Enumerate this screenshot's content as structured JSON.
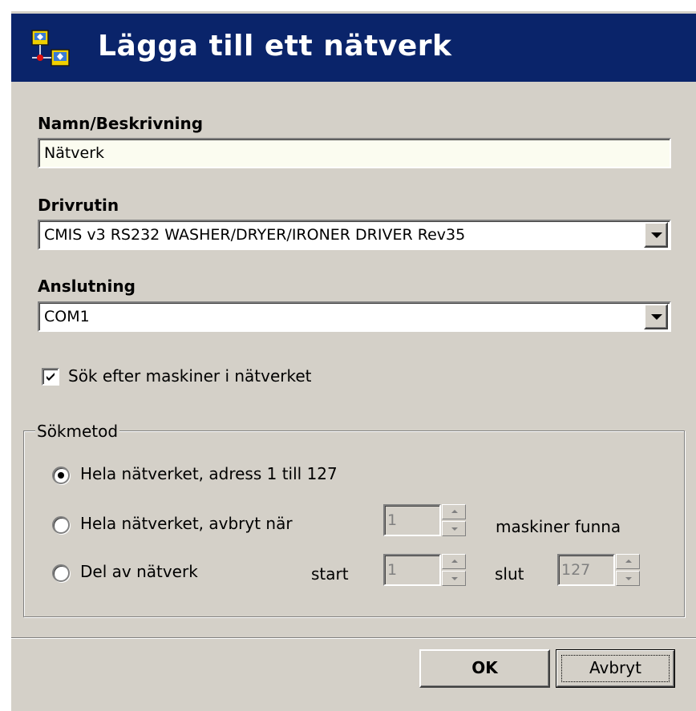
{
  "dialog": {
    "title": "Lägga till ett nätverk",
    "icon": "network-icon"
  },
  "name_section": {
    "label": "Namn/Beskrivning",
    "value": "Nätverk"
  },
  "driver_section": {
    "label": "Drivrutin",
    "selected": "CMIS v3 RS232 WASHER/DRYER/IRONER DRIVER Rev35"
  },
  "connection_section": {
    "label": "Anslutning",
    "selected": "COM1"
  },
  "search_checkbox": {
    "label": "Sök efter maskiner i nätverket",
    "checked": true
  },
  "search_method": {
    "title": "Sökmetod",
    "option_all": "Hela nätverket, adress 1 till 127",
    "option_stop": "Hela nätverket, avbryt när",
    "option_stop_value": "1",
    "option_stop_suffix": "maskiner funna",
    "option_part": "Del av nätverk",
    "start_label": "start",
    "start_value": "1",
    "end_label": "slut",
    "end_value": "127",
    "selected_option": "option_all"
  },
  "buttons": {
    "ok": "OK",
    "cancel": "Avbryt"
  },
  "colors": {
    "titlebar": "#0a246a",
    "dialog_bg": "#d4d0c8"
  }
}
